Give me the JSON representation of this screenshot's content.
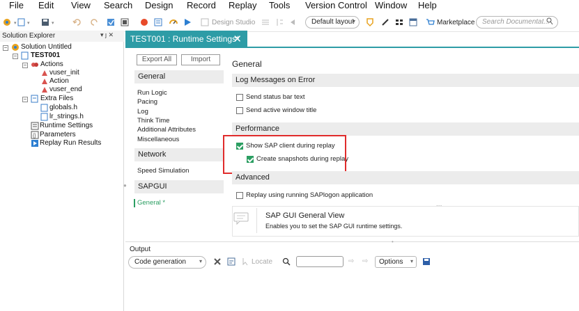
{
  "menu": [
    "File",
    "Edit",
    "View",
    "Search",
    "Design",
    "Record",
    "Replay",
    "Tools",
    "Version Control",
    "Window",
    "Help"
  ],
  "toolbar": {
    "design_studio": "Design Studio",
    "layout_combo": "Default layout",
    "marketplace": "Marketplace",
    "search_placeholder": "Search Documentat..."
  },
  "solution_explorer": {
    "title": "Solution Explorer",
    "pin": "▾ ȷ ✕",
    "solution": "Solution Untitled",
    "script": "TEST001",
    "actions": "Actions",
    "action_items": [
      "vuser_init",
      "Action",
      "vuser_end"
    ],
    "extra_files": "Extra Files",
    "file_items": [
      "globals.h",
      "lr_strings.h"
    ],
    "runtime_settings": "Runtime Settings",
    "parameters": "Parameters",
    "replay_results": "Replay Run Results"
  },
  "document_tab": {
    "title": "TEST001 : Runtime Settings*",
    "close": "✕"
  },
  "settings": {
    "export_button": "Export All",
    "import_button": "Import",
    "nav": {
      "general_header": "General",
      "general_items": [
        "Run Logic",
        "Pacing",
        "Log",
        "Think Time",
        "Additional Attributes",
        "Miscellaneous"
      ],
      "network_header": "Network",
      "network_items": [
        "Speed Simulation"
      ],
      "sapgui_header": "SAPGUI",
      "sapgui_items": [
        "General *"
      ]
    },
    "page_title": "General",
    "groups": {
      "log": "Log Messages on Error",
      "performance": "Performance",
      "advanced": "Advanced"
    },
    "options": {
      "status_bar": {
        "label": "Send status bar text",
        "checked": false
      },
      "active_window": {
        "label": "Send active window title",
        "checked": false
      },
      "show_sap_client": {
        "label": "Show SAP client during replay",
        "checked": true
      },
      "create_snapshots": {
        "label": "Create snapshots during replay",
        "checked": true
      },
      "running_saplogon": {
        "label": "Replay using running SAPlogon application",
        "checked": false
      }
    },
    "info": {
      "title": "SAP GUI General View",
      "description": "Enables you to set the SAP GUI runtime settings."
    }
  },
  "output": {
    "title": "Output",
    "source_combo": "Code generation",
    "locate": "Locate",
    "options": "Options"
  },
  "colors": {
    "accent": "#2d9ca6",
    "check": "#2b9e62",
    "highlight": "#e02b2b"
  }
}
